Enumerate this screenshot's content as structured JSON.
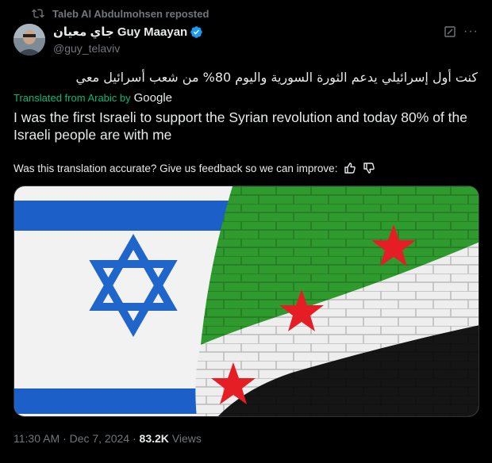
{
  "repost": {
    "label": "Taleb Al Abdulmohsen reposted",
    "icon": "repost-icon"
  },
  "author": {
    "display_name": "جاي معيان Guy Maayan",
    "handle": "@guy_telaviv",
    "verified": true,
    "avatar": "avatar"
  },
  "actions": {
    "grok_icon": "grok-icon",
    "more_label": "···"
  },
  "post": {
    "original_text": "كنت أول إسرائيلي يدعم الثورة السورية واليوم 80% من شعب أسرائيل معي",
    "translated_from": "Translated from Arabic by",
    "translator": "Google",
    "translation": "I was the first Israeli to support the Syrian revolution and today 80% of the Israeli people are with me",
    "feedback_prompt": "Was this translation accurate? Give us feedback so we can improve:"
  },
  "media": {
    "description_icon": "israel-syria-flags-image"
  },
  "meta": {
    "time": "11:30 AM",
    "separator": "·",
    "date": "Dec 7, 2024",
    "views_count": "83.2K",
    "views_label": "Views"
  },
  "colors": {
    "background": "#000000",
    "text": "#e7e9ea",
    "muted": "#71767b",
    "green": "#00ba7c",
    "verified": "#1d9bf0"
  }
}
